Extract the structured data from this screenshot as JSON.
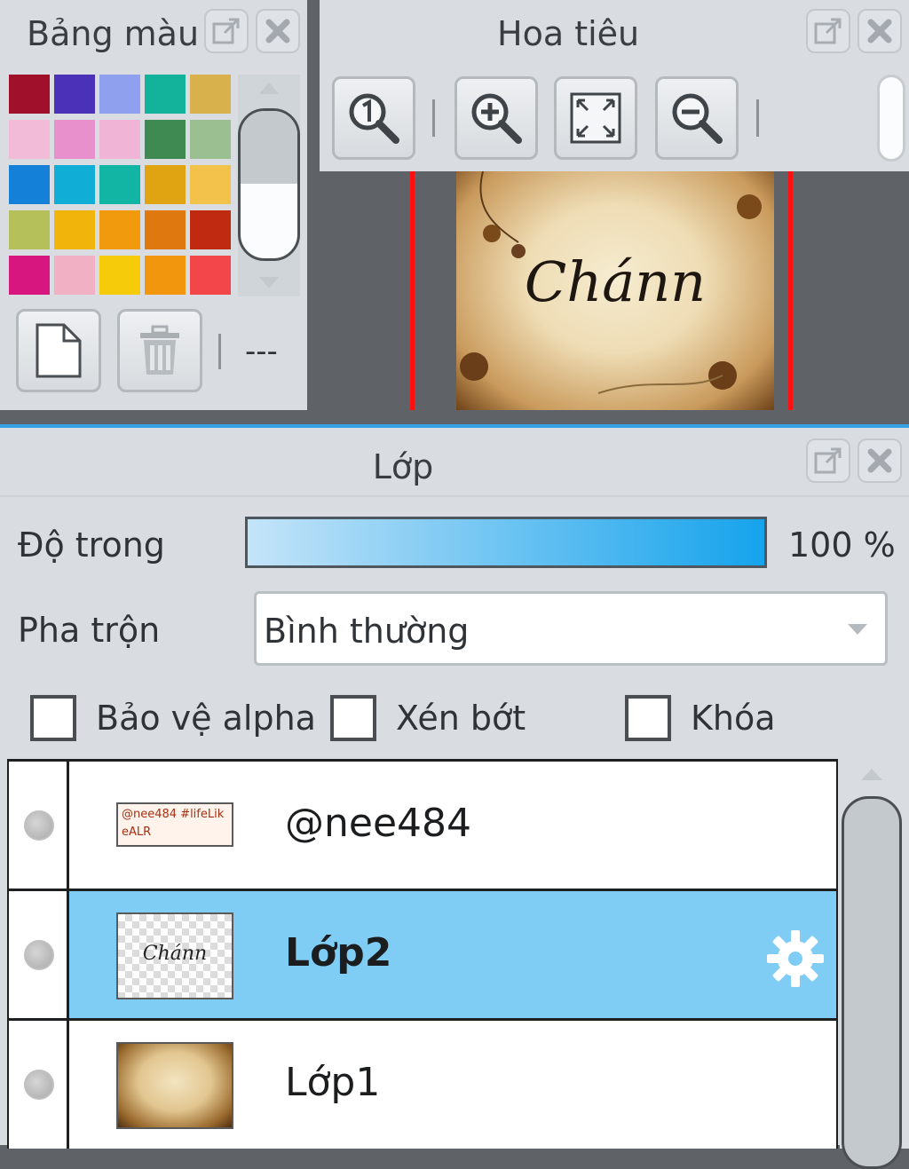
{
  "palette": {
    "title": "Bảng màu",
    "swatch_rows": [
      [
        "#a0102a",
        "#4b30b8",
        "#8ea0ee",
        "#12b39a",
        "#d8b04c"
      ],
      [
        "#f2bcd8",
        "#e890cc",
        "#f0b4d6",
        "#3f8a52",
        "#9cbf92"
      ],
      [
        "#1580d8",
        "#10aed6",
        "#12b5a4",
        "#e0a412",
        "#f2c24a"
      ],
      [
        "#b6c05a",
        "#f0b40a",
        "#f29a0e",
        "#e07810",
        "#c02a10"
      ],
      [
        "#d81680",
        "#f2b0c4",
        "#f6cc0a",
        "#f2960e",
        "#f2464a"
      ]
    ],
    "dash_text": "---",
    "icons": {
      "new": "new-document-icon",
      "delete": "trash-icon",
      "popout": "popout-icon",
      "close": "close-icon"
    }
  },
  "navigator": {
    "title": "Hoa tiêu",
    "preview_text": "Chánn",
    "icons": {
      "actual_size": "zoom-actual-size-icon",
      "zoom_in": "zoom-in-icon",
      "fit": "fit-to-view-icon",
      "zoom_out": "zoom-out-icon"
    }
  },
  "layers": {
    "title": "Lớp",
    "opacity_label": "Độ trong",
    "opacity_value": "100 %",
    "opacity_fraction": 1.0,
    "blend_label": "Pha trộn",
    "blend_value": "Bình thường",
    "checkboxes": [
      {
        "label": "Bảo vệ alpha",
        "checked": false
      },
      {
        "label": "Xén bớt",
        "checked": false
      },
      {
        "label": "Khóa",
        "checked": false
      }
    ],
    "items": [
      {
        "name": "@nee484",
        "selected": false,
        "thumb_text": "@nee484 #lifeLikeALR"
      },
      {
        "name": "Lớp2",
        "selected": true,
        "thumb_text": "Chánn"
      },
      {
        "name": "Lớp1",
        "selected": false
      }
    ],
    "accent_color": "#37a1e8",
    "selected_color": "#7fcdf5"
  }
}
